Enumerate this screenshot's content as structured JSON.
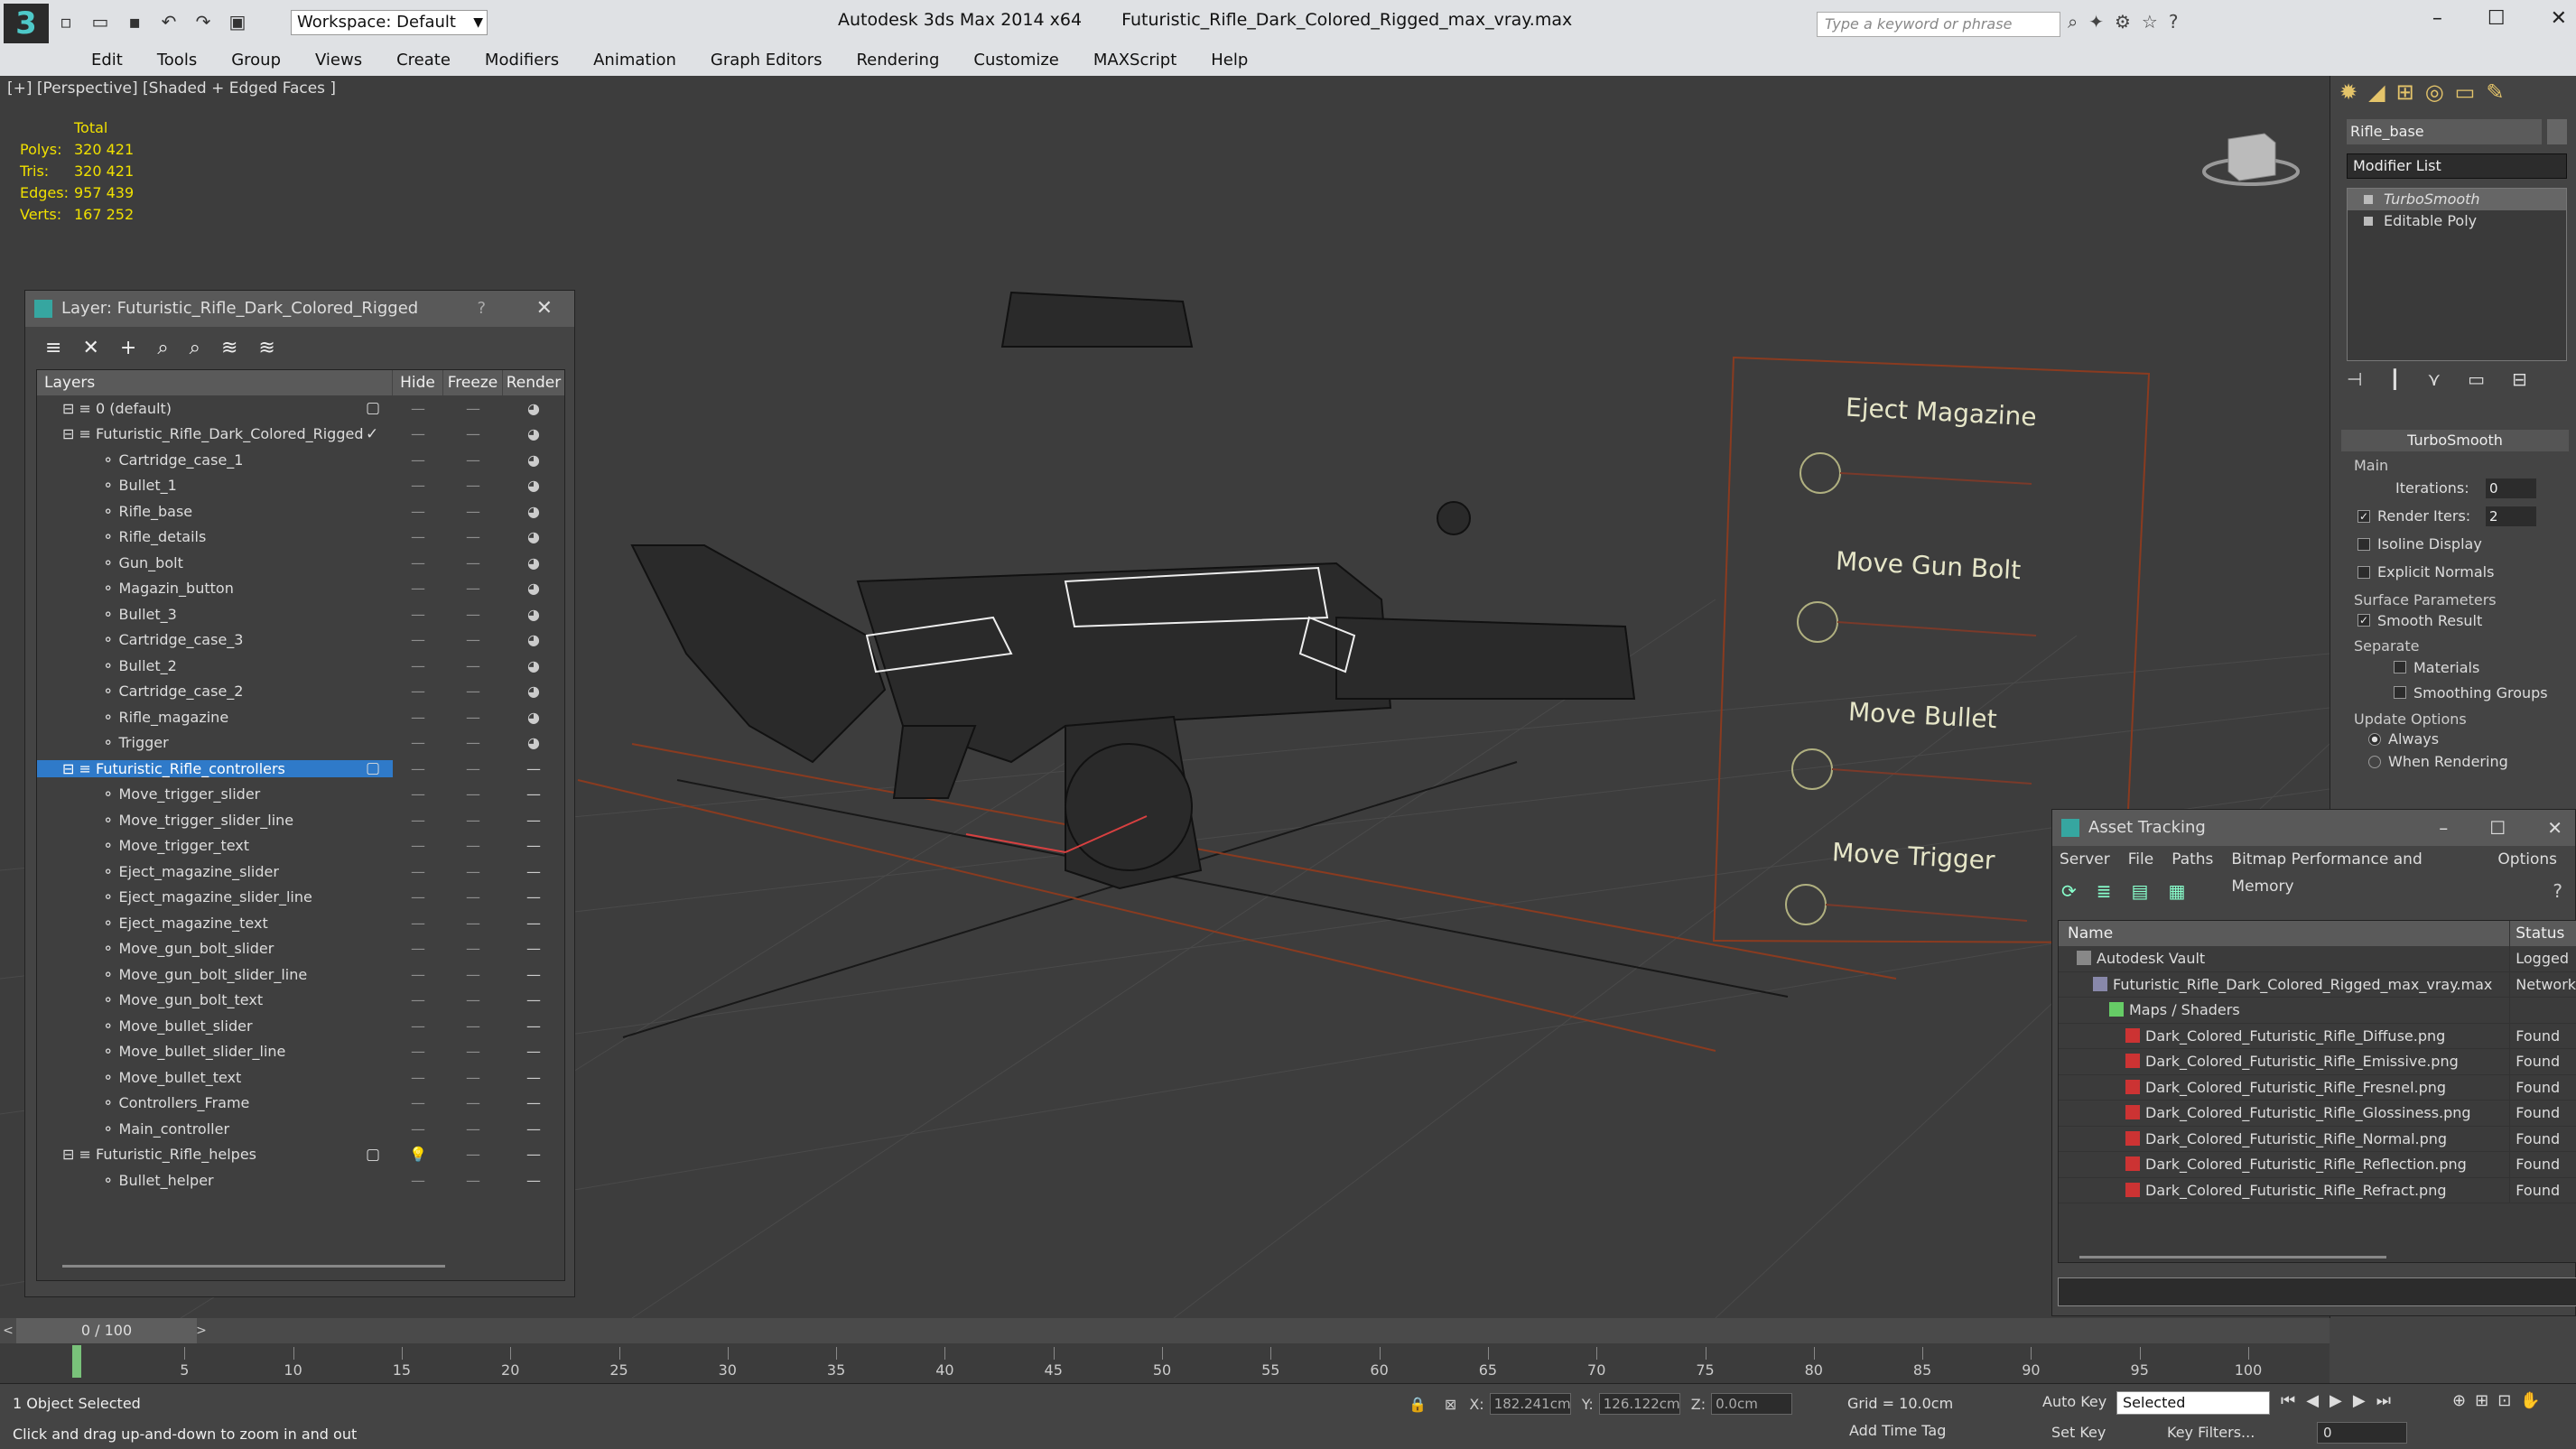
{
  "titlebar": {
    "workspace_label": "Workspace: Default",
    "app_name": "Autodesk 3ds Max  2014 x64",
    "file_name": "Futuristic_Rifle_Dark_Colored_Rigged_max_vray.max",
    "search_placeholder": "Type a keyword or phrase"
  },
  "menu": [
    "Edit",
    "Tools",
    "Group",
    "Views",
    "Create",
    "Modifiers",
    "Animation",
    "Graph Editors",
    "Rendering",
    "Customize",
    "MAXScript",
    "Help"
  ],
  "viewport": {
    "label": "[+] [Perspective] [Shaded + Edged Faces ]",
    "stats_header": "Total",
    "stats": [
      {
        "k": "Polys:",
        "v": "320 421"
      },
      {
        "k": "Tris:",
        "v": "320 421"
      },
      {
        "k": "Edges:",
        "v": "957 439"
      },
      {
        "k": "Verts:",
        "v": "167 252"
      }
    ],
    "controller_labels": [
      "Eject Magazine",
      "Move Gun Bolt",
      "Move Bullet",
      "Move Trigger"
    ]
  },
  "layer_window": {
    "title": "Layer: Futuristic_Rifle_Dark_Colored_Rigged",
    "columns": [
      "Layers",
      "Hide",
      "Freeze",
      "Render"
    ],
    "rows": [
      {
        "name": "0 (default)",
        "level": 0,
        "type": "layer",
        "box": true
      },
      {
        "name": "Futuristic_Rifle_Dark_Colored_Rigged",
        "level": 0,
        "type": "layer",
        "current": true
      },
      {
        "name": "Cartridge_case_1",
        "level": 1,
        "type": "obj"
      },
      {
        "name": "Bullet_1",
        "level": 1,
        "type": "obj"
      },
      {
        "name": "Rifle_base",
        "level": 1,
        "type": "obj"
      },
      {
        "name": "Rifle_details",
        "level": 1,
        "type": "obj"
      },
      {
        "name": "Gun_bolt",
        "level": 1,
        "type": "obj"
      },
      {
        "name": "Magazin_button",
        "level": 1,
        "type": "obj"
      },
      {
        "name": "Bullet_3",
        "level": 1,
        "type": "obj"
      },
      {
        "name": "Cartridge_case_3",
        "level": 1,
        "type": "obj"
      },
      {
        "name": "Bullet_2",
        "level": 1,
        "type": "obj"
      },
      {
        "name": "Cartridge_case_2",
        "level": 1,
        "type": "obj"
      },
      {
        "name": "Rifle_magazine",
        "level": 1,
        "type": "obj"
      },
      {
        "name": "Trigger",
        "level": 1,
        "type": "obj"
      },
      {
        "name": "Futuristic_Rifle_controllers",
        "level": 0,
        "type": "layer",
        "selected": true,
        "box": true
      },
      {
        "name": "Move_trigger_slider",
        "level": 1,
        "type": "obj"
      },
      {
        "name": "Move_trigger_slider_line",
        "level": 1,
        "type": "obj"
      },
      {
        "name": "Move_trigger_text",
        "level": 1,
        "type": "obj"
      },
      {
        "name": "Eject_magazine_slider",
        "level": 1,
        "type": "obj"
      },
      {
        "name": "Eject_magazine_slider_line",
        "level": 1,
        "type": "obj"
      },
      {
        "name": "Eject_magazine_text",
        "level": 1,
        "type": "obj"
      },
      {
        "name": "Move_gun_bolt_slider",
        "level": 1,
        "type": "obj"
      },
      {
        "name": "Move_gun_bolt_slider_line",
        "level": 1,
        "type": "obj"
      },
      {
        "name": "Move_gun_bolt_text",
        "level": 1,
        "type": "obj"
      },
      {
        "name": "Move_bullet_slider",
        "level": 1,
        "type": "obj"
      },
      {
        "name": "Move_bullet_slider_line",
        "level": 1,
        "type": "obj"
      },
      {
        "name": "Move_bullet_text",
        "level": 1,
        "type": "obj"
      },
      {
        "name": "Controllers_Frame",
        "level": 1,
        "type": "obj"
      },
      {
        "name": "Main_controller",
        "level": 1,
        "type": "obj"
      },
      {
        "name": "Futuristic_Rifle_helpes",
        "level": 0,
        "type": "layer",
        "box": true,
        "hidden_bulb": true
      },
      {
        "name": "Bullet_helper",
        "level": 1,
        "type": "obj"
      }
    ]
  },
  "command_panel": {
    "object_name": "Rifle_base",
    "modifier_list_label": "Modifier List",
    "stack": [
      "TurboSmooth",
      "Editable Poly"
    ],
    "rollout_title": "TurboSmooth",
    "main_group": "Main",
    "iterations_label": "Iterations:",
    "iterations_value": "0",
    "render_iters_label": "Render Iters:",
    "render_iters_value": "2",
    "isoline_label": "Isoline Display",
    "explicit_normals_label": "Explicit Normals",
    "surface_group": "Surface Parameters",
    "smooth_result_label": "Smooth Result",
    "separate_label": "Separate",
    "materials_label": "Materials",
    "smoothing_groups_label": "Smoothing Groups",
    "update_group": "Update Options",
    "always_label": "Always",
    "when_rendering_label": "When Rendering"
  },
  "asset_tracking": {
    "title": "Asset Tracking",
    "menu": [
      "Server",
      "File",
      "Paths",
      "Bitmap Performance and Memory",
      "Options"
    ],
    "columns": [
      "Name",
      "Status"
    ],
    "rows": [
      {
        "name": "Autodesk Vault",
        "status": "Logged",
        "level": 0,
        "icon": "vault"
      },
      {
        "name": "Futuristic_Rifle_Dark_Colored_Rigged_max_vray.max",
        "status": "Network",
        "level": 1,
        "icon": "file"
      },
      {
        "name": "Maps / Shaders",
        "status": "",
        "level": 2,
        "icon": "maps"
      },
      {
        "name": "Dark_Colored_Futuristic_Rifle_Diffuse.png",
        "status": "Found",
        "level": 3,
        "icon": "png"
      },
      {
        "name": "Dark_Colored_Futuristic_Rifle_Emissive.png",
        "status": "Found",
        "level": 3,
        "icon": "png"
      },
      {
        "name": "Dark_Colored_Futuristic_Rifle_Fresnel.png",
        "status": "Found",
        "level": 3,
        "icon": "png"
      },
      {
        "name": "Dark_Colored_Futuristic_Rifle_Glossiness.png",
        "status": "Found",
        "level": 3,
        "icon": "png"
      },
      {
        "name": "Dark_Colored_Futuristic_Rifle_Normal.png",
        "status": "Found",
        "level": 3,
        "icon": "png"
      },
      {
        "name": "Dark_Colored_Futuristic_Rifle_Reflection.png",
        "status": "Found",
        "level": 3,
        "icon": "png"
      },
      {
        "name": "Dark_Colored_Futuristic_Rifle_Refract.png",
        "status": "Found",
        "level": 3,
        "icon": "png"
      }
    ]
  },
  "timeline": {
    "frame_label": "0 / 100",
    "ticks": [
      "5",
      "10",
      "15",
      "20",
      "25",
      "30",
      "35",
      "40",
      "45",
      "50",
      "55",
      "60",
      "65",
      "70",
      "75",
      "80",
      "85",
      "90",
      "95",
      "100"
    ]
  },
  "statusbar": {
    "selection": "1 Object Selected",
    "prompt": "Click and drag up-and-down to zoom in and out",
    "x_label": "X:",
    "x_value": "182.241cm",
    "y_label": "Y:",
    "y_value": "126.122cm",
    "z_label": "Z:",
    "z_value": "0.0cm",
    "grid": "Grid = 10.0cm",
    "add_time_tag": "Add Time Tag",
    "auto_key": "Auto Key",
    "set_key": "Set Key",
    "selected_option": "Selected",
    "key_filters": "Key Filters...",
    "frame_value": "0"
  }
}
